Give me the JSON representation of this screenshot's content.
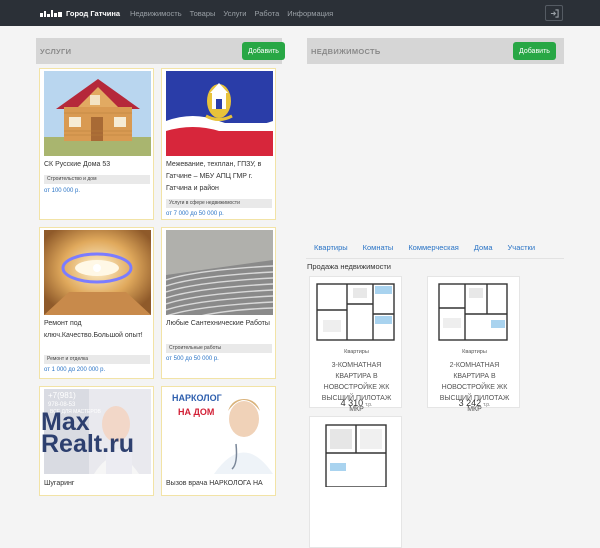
{
  "navbar": {
    "brand": "Город Гатчина",
    "items": [
      "Недвижимость",
      "Товары",
      "Услуги",
      "Работа",
      "Информация"
    ]
  },
  "services": {
    "heading": "УСЛУГИ",
    "add_label": "Добавить",
    "cards": [
      {
        "title": "СК Русские Дома 53",
        "category": "Строительство и дом",
        "price": "от 100 000 р."
      },
      {
        "title": "Межевание, техплан, ГПЗУ, в Гатчине – МБУ АПЦ ГМР г. Гатчина и район",
        "category": "Услуги в сфере недвижимости",
        "price": "от 7 000 до 50 000 р."
      },
      {
        "title": "Ремонт под ключ.Качество.Большой опыт!",
        "category": "Ремонт и отделка",
        "price": "от 1 000 до 200 000 р."
      },
      {
        "title": "Любые Сантехнические Работы",
        "category": "Строительные работы",
        "price": "от 500 до 50 000 р."
      },
      {
        "title": "Шугаринг",
        "overlay1": "+7(981)",
        "overlay2": "978-08-53",
        "overlay3": "ВСЕ ДЛЯ МАСТЕРОВ"
      },
      {
        "title": "Вызов врача НАРКОЛОГА НА",
        "overlay1": "НАРКОЛОГ",
        "overlay2": "НА ДОМ"
      }
    ]
  },
  "realty": {
    "heading": "НЕДВИЖИМОСТЬ",
    "add_label": "Добавить",
    "tabs": [
      "Квартиры",
      "Комнаты",
      "Коммерческая",
      "Дома",
      "Участки"
    ],
    "section_title": "Продажа недвижимости",
    "listings": [
      {
        "category": "Квартиры",
        "title": "3-КОМНАТНАЯ КВАРТИРА В НОВОСТРОЙКЕ ЖК ВЫСШИЙ ПИЛОТАЖ МКР",
        "price": "4 310",
        "unit": "т.р."
      },
      {
        "category": "Квартиры",
        "title": "2-КОМНАТНАЯ КВАРТИРА В НОВОСТРОЙКЕ ЖК ВЫСШИЙ ПИЛОТАЖ МКР",
        "price": "3 242",
        "unit": "т.р."
      },
      {
        "category": "",
        "title": "",
        "price": "",
        "unit": ""
      }
    ]
  },
  "watermark": {
    "line1": "Max",
    "line2": "Realt.ru"
  }
}
